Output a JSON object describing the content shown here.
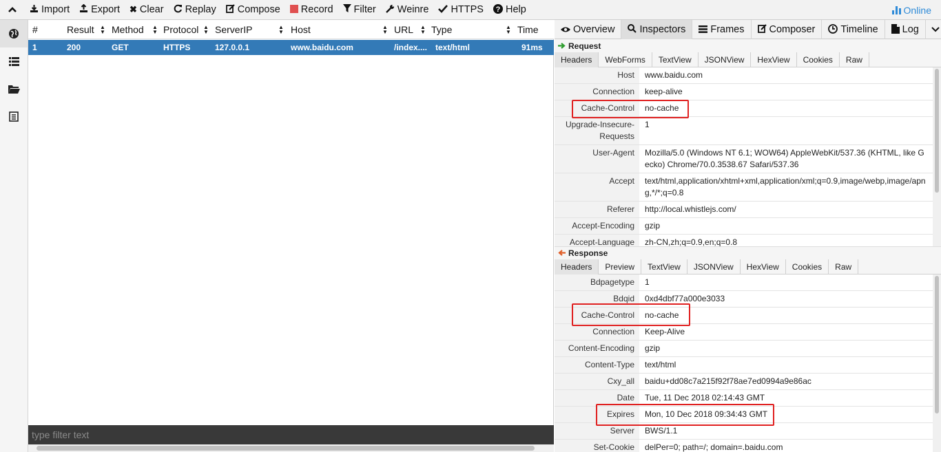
{
  "menu": {
    "collapse_icon": "chevron-up-icon",
    "items": [
      {
        "label": "Import",
        "icon": "import-icon"
      },
      {
        "label": "Export",
        "icon": "export-icon"
      },
      {
        "label": "Clear",
        "icon": "clear-icon"
      },
      {
        "label": "Replay",
        "icon": "replay-icon"
      },
      {
        "label": "Compose",
        "icon": "compose-icon"
      },
      {
        "label": "Record",
        "icon": "record-icon"
      },
      {
        "label": "Filter",
        "icon": "filter-icon"
      },
      {
        "label": "Weinre",
        "icon": "wrench-icon"
      },
      {
        "label": "HTTPS",
        "icon": "check-icon"
      },
      {
        "label": "Help",
        "icon": "help-icon"
      }
    ],
    "online_label": "Online",
    "record_color": "#e05050",
    "online_color": "#2f8bd8"
  },
  "sidebar": {
    "items": [
      "network-icon",
      "rules-icon",
      "values-icon",
      "plugins-icon"
    ]
  },
  "network": {
    "columns": [
      "#",
      "Result",
      "Method",
      "Protocol",
      "ServerIP",
      "Host",
      "URL",
      "Type",
      "Time"
    ],
    "rows": [
      {
        "num": "1",
        "result": "200",
        "method": "GET",
        "protocol": "HTTPS",
        "serverip": "127.0.0.1",
        "host": "www.baidu.com",
        "url": "/index....",
        "type": "text/html",
        "time": "91ms"
      }
    ],
    "selected_color": "#337ab7",
    "filter_placeholder": "type filter text"
  },
  "tabs": [
    {
      "label": "Overview",
      "icon": "overview-icon"
    },
    {
      "label": "Inspectors",
      "icon": "search-icon",
      "active": true
    },
    {
      "label": "Frames",
      "icon": "frames-icon"
    },
    {
      "label": "Composer",
      "icon": "composer-icon"
    },
    {
      "label": "Timeline",
      "icon": "timeline-icon"
    },
    {
      "label": "Log",
      "icon": "log-icon"
    }
  ],
  "request": {
    "title": "Request",
    "subtabs": [
      "Headers",
      "WebForms",
      "TextView",
      "JSONView",
      "HexView",
      "Cookies",
      "Raw"
    ],
    "headers": [
      {
        "key": "Host",
        "value": "www.baidu.com"
      },
      {
        "key": "Connection",
        "value": "keep-alive"
      },
      {
        "key": "Cache-Control",
        "value": "no-cache"
      },
      {
        "key": "Upgrade-Insecure-Requests",
        "value": "1"
      },
      {
        "key": "User-Agent",
        "value": "Mozilla/5.0 (Windows NT 6.1; WOW64) AppleWebKit/537.36 (KHTML, like Gecko) Chrome/70.0.3538.67 Safari/537.36"
      },
      {
        "key": "Accept",
        "value": "text/html,application/xhtml+xml,application/xml;q=0.9,image/webp,image/apng,*/*;q=0.8"
      },
      {
        "key": "Referer",
        "value": "http://local.whistlejs.com/"
      },
      {
        "key": "Accept-Encoding",
        "value": "gzip"
      },
      {
        "key": "Accept-Language",
        "value": "zh-CN,zh;q=0.9,en;q=0.8"
      }
    ]
  },
  "response": {
    "title": "Response",
    "subtabs": [
      "Headers",
      "Preview",
      "TextView",
      "JSONView",
      "HexView",
      "Cookies",
      "Raw"
    ],
    "headers": [
      {
        "key": "Bdpagetype",
        "value": "1"
      },
      {
        "key": "Bdqid",
        "value": "0xd4dbf77a000e3033"
      },
      {
        "key": "Cache-Control",
        "value": "no-cache"
      },
      {
        "key": "Connection",
        "value": "Keep-Alive"
      },
      {
        "key": "Content-Encoding",
        "value": "gzip"
      },
      {
        "key": "Content-Type",
        "value": "text/html"
      },
      {
        "key": "Cxy_all",
        "value": "baidu+dd08c7a215f92f78ae7ed0994a9e86ac"
      },
      {
        "key": "Date",
        "value": "Tue, 11 Dec 2018 02:14:43 GMT"
      },
      {
        "key": "Expires",
        "value": "Mon, 10 Dec 2018 09:34:43 GMT"
      },
      {
        "key": "Server",
        "value": "BWS/1.1"
      },
      {
        "key": "Set-Cookie",
        "value": "delPer=0; path=/; domain=.baidu.com"
      }
    ]
  },
  "highlight_color": "#e02020"
}
